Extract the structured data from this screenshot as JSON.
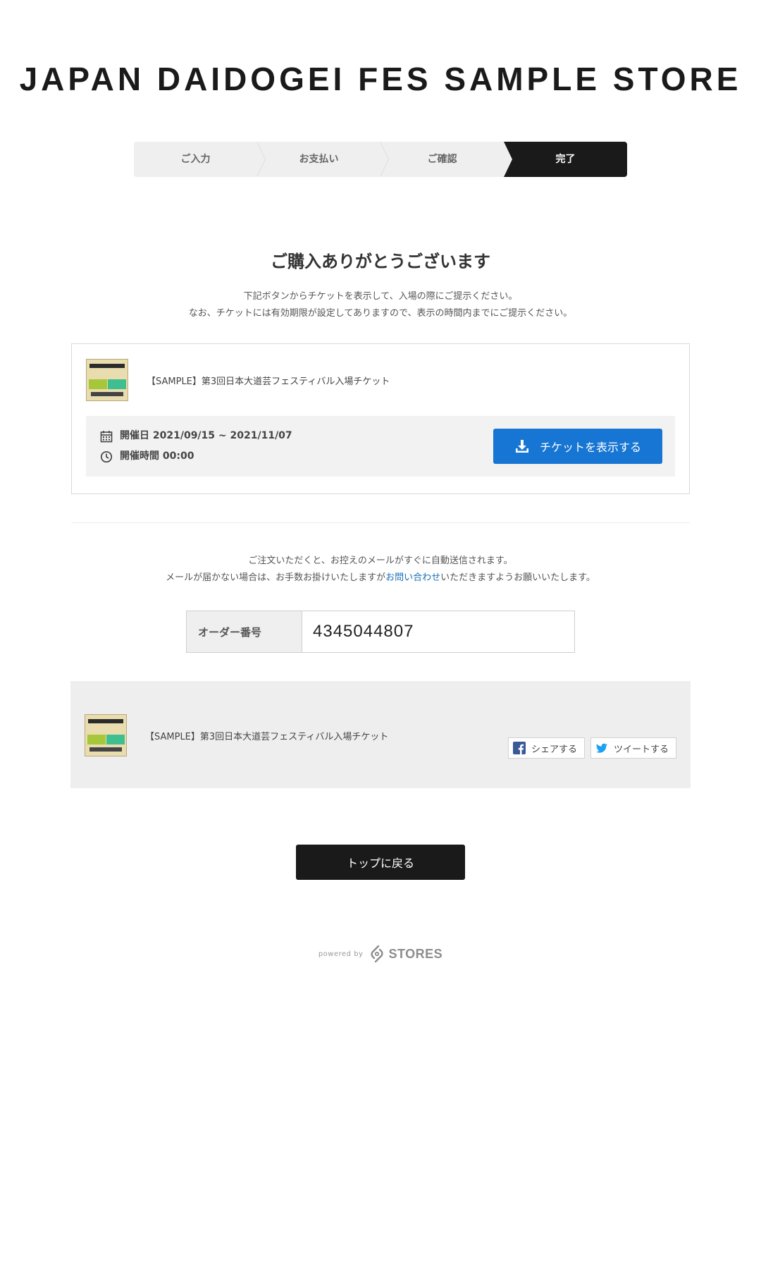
{
  "store": {
    "title": "JAPAN DAIDOGEI FES SAMPLE STORE"
  },
  "steps": [
    {
      "label": "ご入力"
    },
    {
      "label": "お支払い"
    },
    {
      "label": "ご確認"
    },
    {
      "label": "完了"
    }
  ],
  "main": {
    "heading": "ご購入ありがとうございます",
    "note_line1": "下記ボタンからチケットを表示して、入場の際にご提示ください。",
    "note_line2": "なお、チケットには有効期限が設定してありますので、表示の時間内までにご提示ください。"
  },
  "ticket": {
    "product_name": "【SAMPLE】第3回日本大道芸フェスティバル入場チケット",
    "date_label": "開催日 2021/09/15 ~ 2021/11/07",
    "time_label": "開催時間 00:00",
    "show_button": "チケットを表示する"
  },
  "order": {
    "note_line1": "ご注文いただくと、お控えのメールがすぐに自動送信されます。",
    "note_line2_pre": "メールが届かない場合は、お手数お掛けいたしますが",
    "note_line2_link": "お問い合わせ",
    "note_line2_post": "いただきますようお願いいたします。",
    "number_label": "オーダー番号",
    "number_value": "4345044807"
  },
  "share": {
    "product_name": "【SAMPLE】第3回日本大道芸フェスティバル入場チケット",
    "facebook_label": "シェアする",
    "twitter_label": "ツイートする"
  },
  "footer": {
    "back_button": "トップに戻る",
    "powered_by": "powered by",
    "brand": "STORES"
  },
  "colors": {
    "primary_button": "#1776d3",
    "dark": "#1a1a1a",
    "link": "#1a6fb5",
    "facebook": "#3b5998",
    "twitter": "#1da1f2"
  }
}
